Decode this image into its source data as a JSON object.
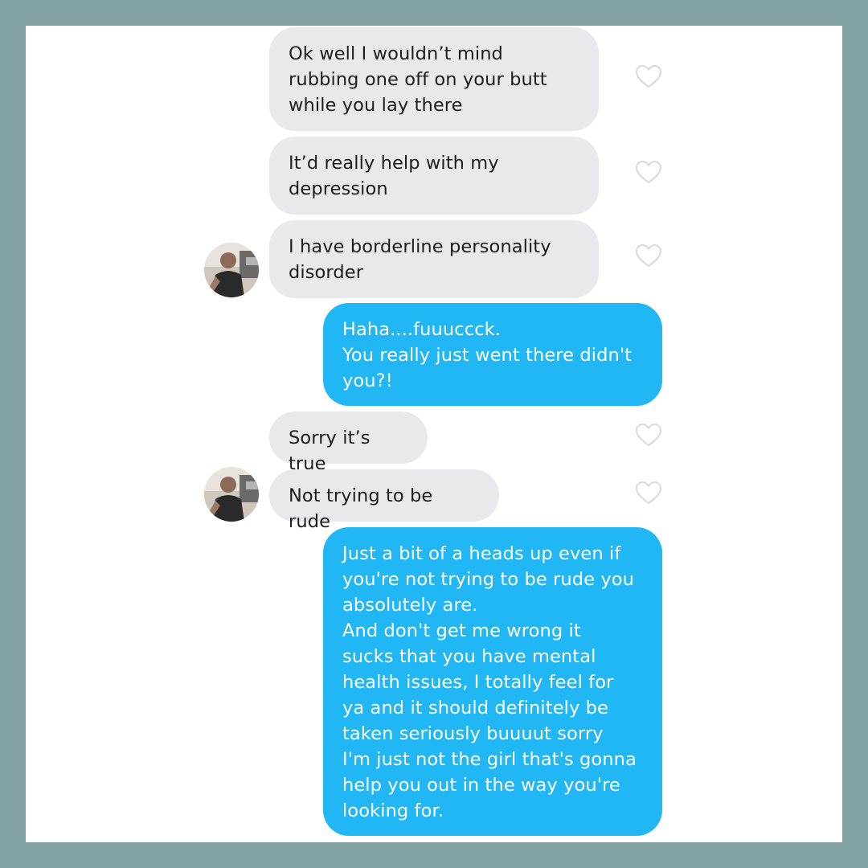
{
  "conversation": {
    "messages": [
      {
        "side": "received",
        "text": "Ok well I wouldn’t mind\nrubbing one off on your butt\nwhile you lay there"
      },
      {
        "side": "received",
        "text": "It’d really help with my\ndepression"
      },
      {
        "side": "received",
        "text": "I have borderline personality\ndisorder"
      },
      {
        "side": "sent",
        "text": "Haha....fuuuccck.\nYou really just went there didn't\nyou?!"
      },
      {
        "side": "received",
        "text": "Sorry it’s true"
      },
      {
        "side": "received",
        "text": "Not trying to be rude"
      },
      {
        "side": "sent",
        "text": "Just a bit of a heads up even if\nyou're not trying to be rude you\nabsolutely are.\nAnd don't get me wrong it\nsucks that you have mental\nhealth issues, I totally feel for\nya and it should definitely be\ntaken seriously buuuut sorry\nI'm just not the girl that's gonna\nhelp you out in the way you're\nlooking for."
      }
    ]
  },
  "icons": {
    "like": "heart-outline-icon",
    "avatar": "user-avatar"
  },
  "colors": {
    "frame_border": "#82a1a1",
    "background": "#ffffff",
    "received_bubble": "#e9e9eb",
    "sent_bubble": "#21b7f5",
    "heart_outline": "#d9d9d9"
  }
}
